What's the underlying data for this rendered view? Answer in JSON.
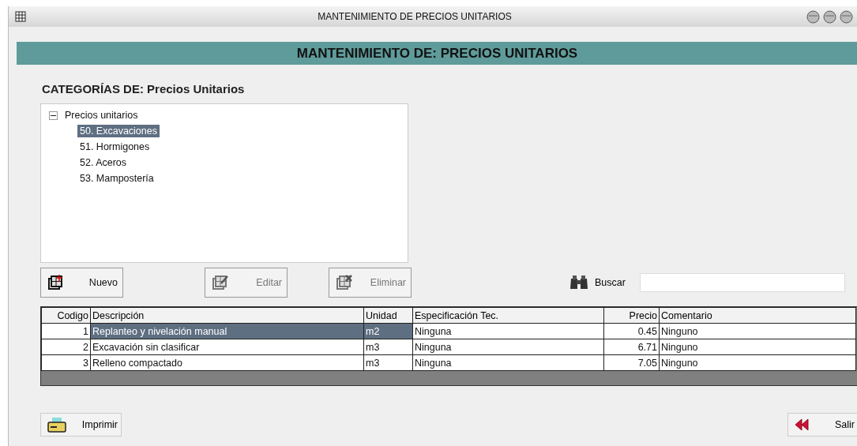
{
  "window": {
    "title": "MANTENIMIENTO DE PRECIOS UNITARIOS"
  },
  "header": "MANTENIMIENTO DE: PRECIOS UNITARIOS",
  "categories_label": "CATEGORÍAS DE:  Precios Unitarios",
  "tree": [
    {
      "label": "Precios unitarios",
      "expanded": true,
      "selected": false,
      "children": [
        {
          "label": "50. Excavaciones",
          "selected": true
        },
        {
          "label": "51. Hormigones",
          "selected": false
        },
        {
          "label": "52. Aceros",
          "selected": false
        },
        {
          "label": "53. Mampostería",
          "selected": false
        }
      ]
    }
  ],
  "actions": [
    {
      "kind": "new",
      "label": "Nuevo",
      "disabled": false
    },
    {
      "kind": "edit",
      "label": "Editar",
      "disabled": true
    },
    {
      "kind": "delete",
      "label": "Eliminar",
      "disabled": true
    }
  ],
  "search": {
    "label": "Buscar"
  },
  "table": {
    "columns": [
      "Codigo",
      "Descripción",
      "Unidad",
      "Especificación Tec.",
      "Precio",
      "Comentario"
    ],
    "rows": [
      {
        "cells": [
          "1",
          "Replanteo y nivelación manual",
          "m2",
          "Ninguna",
          "0.45",
          "Ninguno"
        ],
        "selected": true
      },
      {
        "cells": [
          "2",
          "Excavación sin clasificar",
          "m3",
          "Ninguna",
          "6.71",
          "Ninguno"
        ],
        "selected": false
      },
      {
        "cells": [
          "3",
          "Relleno compactado",
          "m3",
          "Ninguna",
          "7.05",
          "Ninguno"
        ],
        "selected": false
      }
    ]
  },
  "footer": {
    "print": "Imprimir",
    "exit": "Salir"
  }
}
